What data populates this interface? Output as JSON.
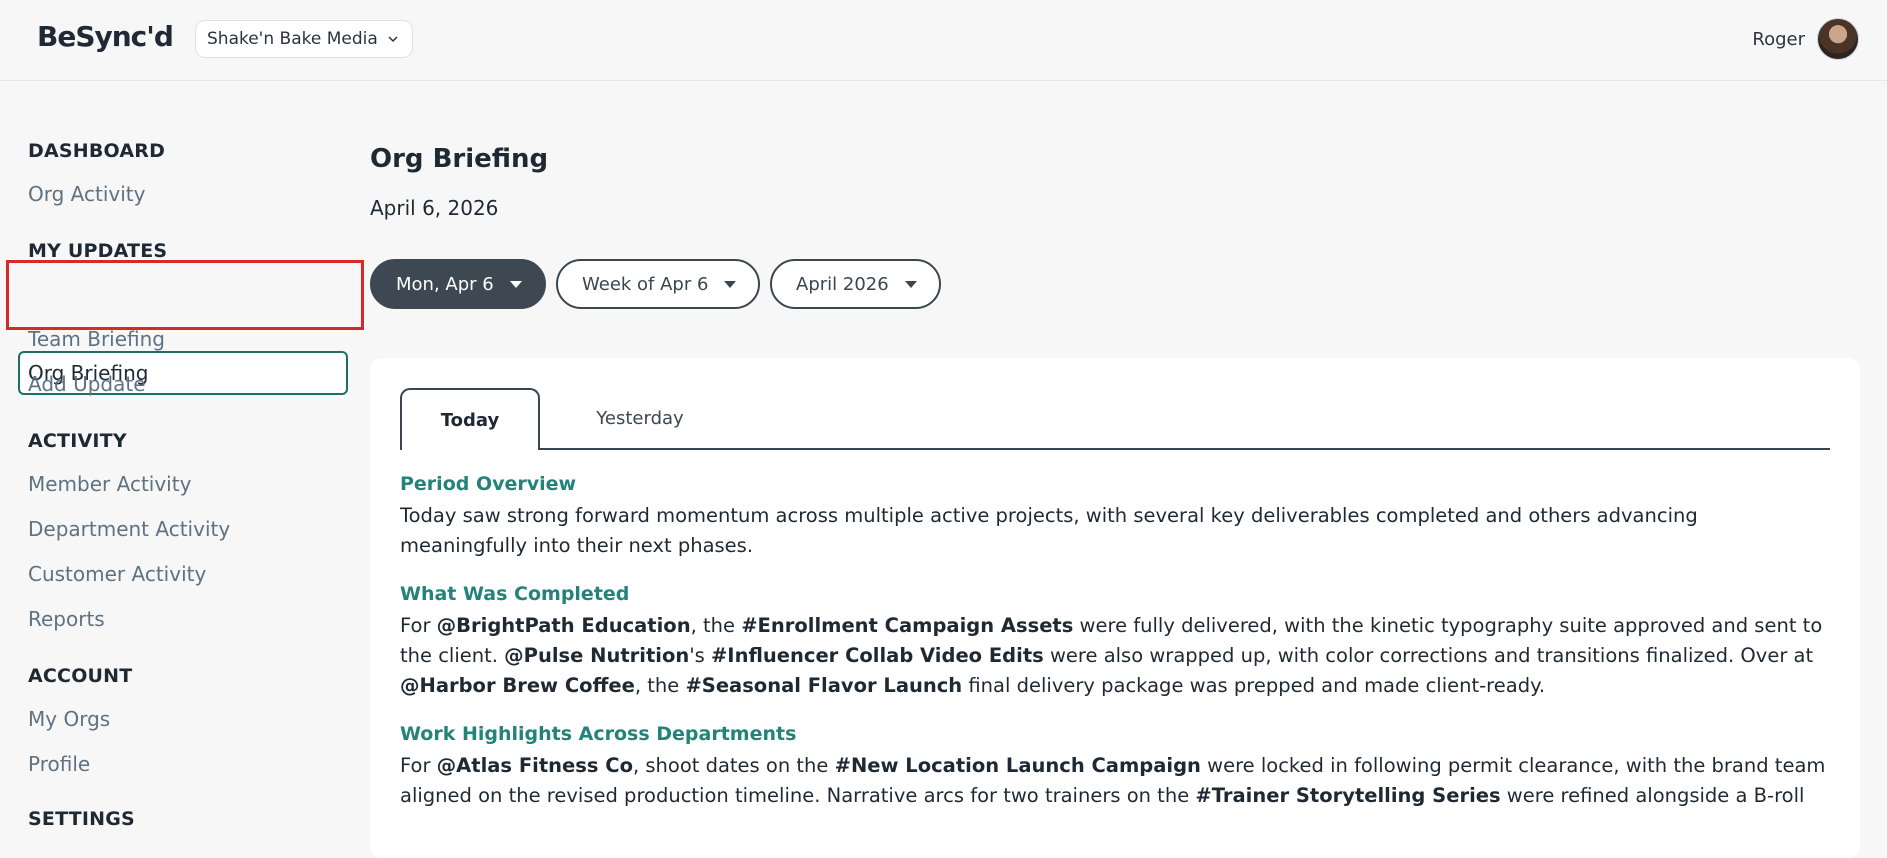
{
  "header": {
    "logo": "BeSync'd",
    "org_name": "Shake'n Bake Media",
    "user_name": "Roger"
  },
  "sidebar": {
    "sections": [
      {
        "heading": "DASHBOARD",
        "items": [
          "Org Activity"
        ]
      },
      {
        "heading": "MY UPDATES",
        "items": [
          "Org Briefing",
          "Team Briefing",
          "Add Update"
        ]
      },
      {
        "heading": "ACTIVITY",
        "items": [
          "Member Activity",
          "Department Activity",
          "Customer Activity",
          "Reports"
        ]
      },
      {
        "heading": "ACCOUNT",
        "items": [
          "My Orgs",
          "Profile"
        ]
      },
      {
        "heading": "SETTINGS",
        "items": []
      }
    ],
    "active_item": "Org Briefing"
  },
  "main": {
    "title": "Org Briefing",
    "date": "April 6, 2026",
    "filters": [
      "Mon, Apr 6",
      "Week of Apr 6",
      "April 2026"
    ],
    "tabs": [
      "Today",
      "Yesterday"
    ],
    "sections": [
      {
        "title": "Period Overview",
        "text": "Today saw strong forward momentum across multiple active projects, with several key deliverables completed and others advancing meaningfully into their next phases."
      },
      {
        "title": "What Was Completed",
        "runs": [
          [
            "For ",
            false
          ],
          [
            "@BrightPath Education",
            true
          ],
          [
            ", the ",
            false
          ],
          [
            "#Enrollment Campaign Assets",
            true
          ],
          [
            " were fully delivered, with the kinetic typography suite approved and sent to the client. ",
            false
          ],
          [
            "@Pulse Nutrition",
            true
          ],
          [
            "'s ",
            false
          ],
          [
            "#Influencer Collab Video Edits",
            true
          ],
          [
            " were also wrapped up, with color corrections and transitions finalized. Over at ",
            false
          ],
          [
            "@Harbor Brew Coffee",
            true
          ],
          [
            ", the ",
            false
          ],
          [
            "#Seasonal Flavor Launch",
            true
          ],
          [
            " final delivery package was prepped and made client-ready.",
            false
          ]
        ]
      },
      {
        "title": "Work Highlights Across Departments",
        "runs": [
          [
            "For ",
            false
          ],
          [
            "@Atlas Fitness Co",
            true
          ],
          [
            ", shoot dates on the ",
            false
          ],
          [
            "#New Location Launch Campaign",
            true
          ],
          [
            " were locked in following permit clearance, with the brand team aligned on the revised production timeline. Narrative arcs for two trainers on the ",
            false
          ],
          [
            "#Trainer Storytelling Series",
            true
          ],
          [
            " were refined alongside a B-roll",
            false
          ]
        ]
      }
    ]
  }
}
